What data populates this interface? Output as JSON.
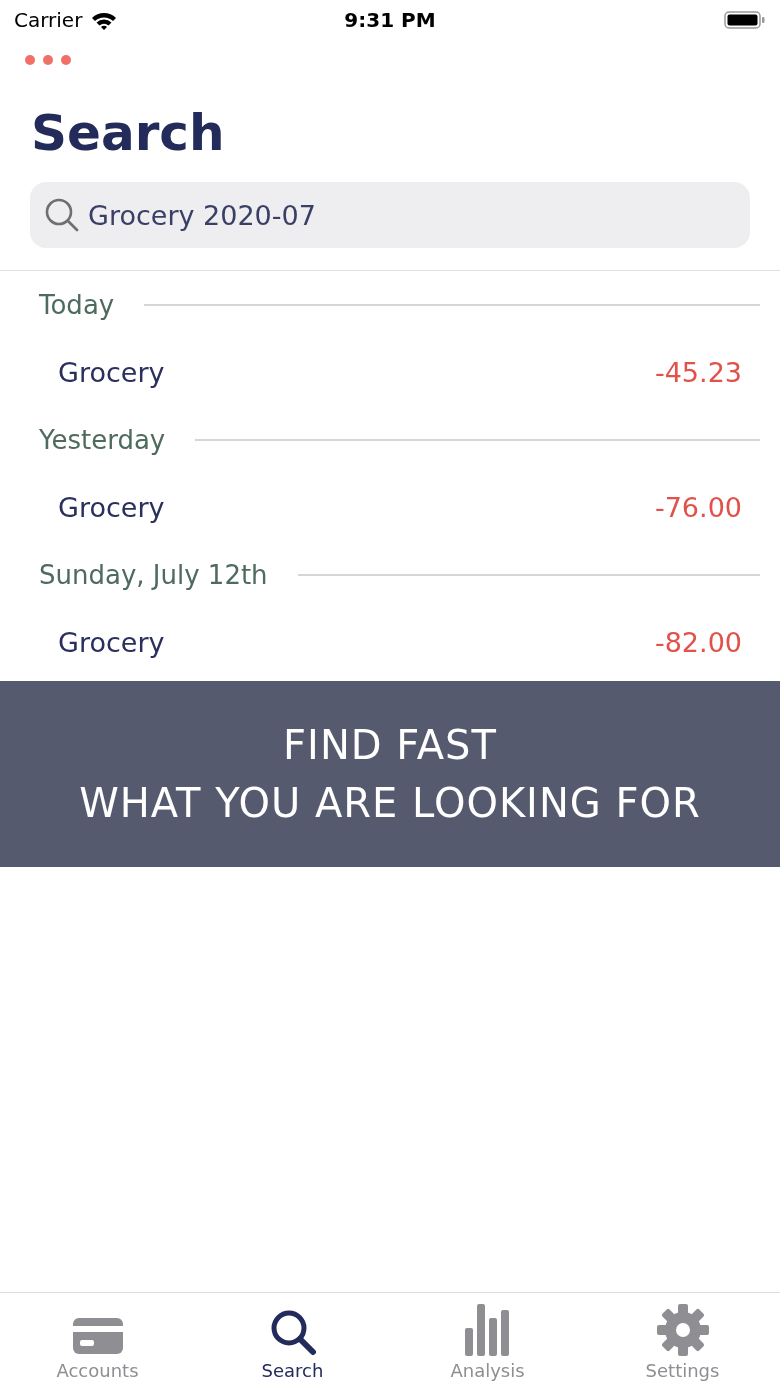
{
  "status_bar": {
    "carrier": "Carrier",
    "time": "9:31 PM"
  },
  "title": "Search",
  "search": {
    "value": "Grocery 2020-07"
  },
  "sections": [
    {
      "header": "Today",
      "rows": [
        {
          "name": "Grocery",
          "amount": "-45.23"
        }
      ]
    },
    {
      "header": "Yesterday",
      "rows": [
        {
          "name": "Grocery",
          "amount": "-76.00"
        }
      ]
    },
    {
      "header": "Sunday, July 12th",
      "rows": [
        {
          "name": "Grocery",
          "amount": "-82.00"
        }
      ]
    }
  ],
  "banner": {
    "lines": [
      "FIND FAST",
      "WHAT YOU ARE LOOKING FOR"
    ]
  },
  "tabs": [
    {
      "label": "Accounts",
      "selected": false
    },
    {
      "label": "Search",
      "selected": true
    },
    {
      "label": "Analysis",
      "selected": false
    },
    {
      "label": "Settings",
      "selected": false
    }
  ]
}
